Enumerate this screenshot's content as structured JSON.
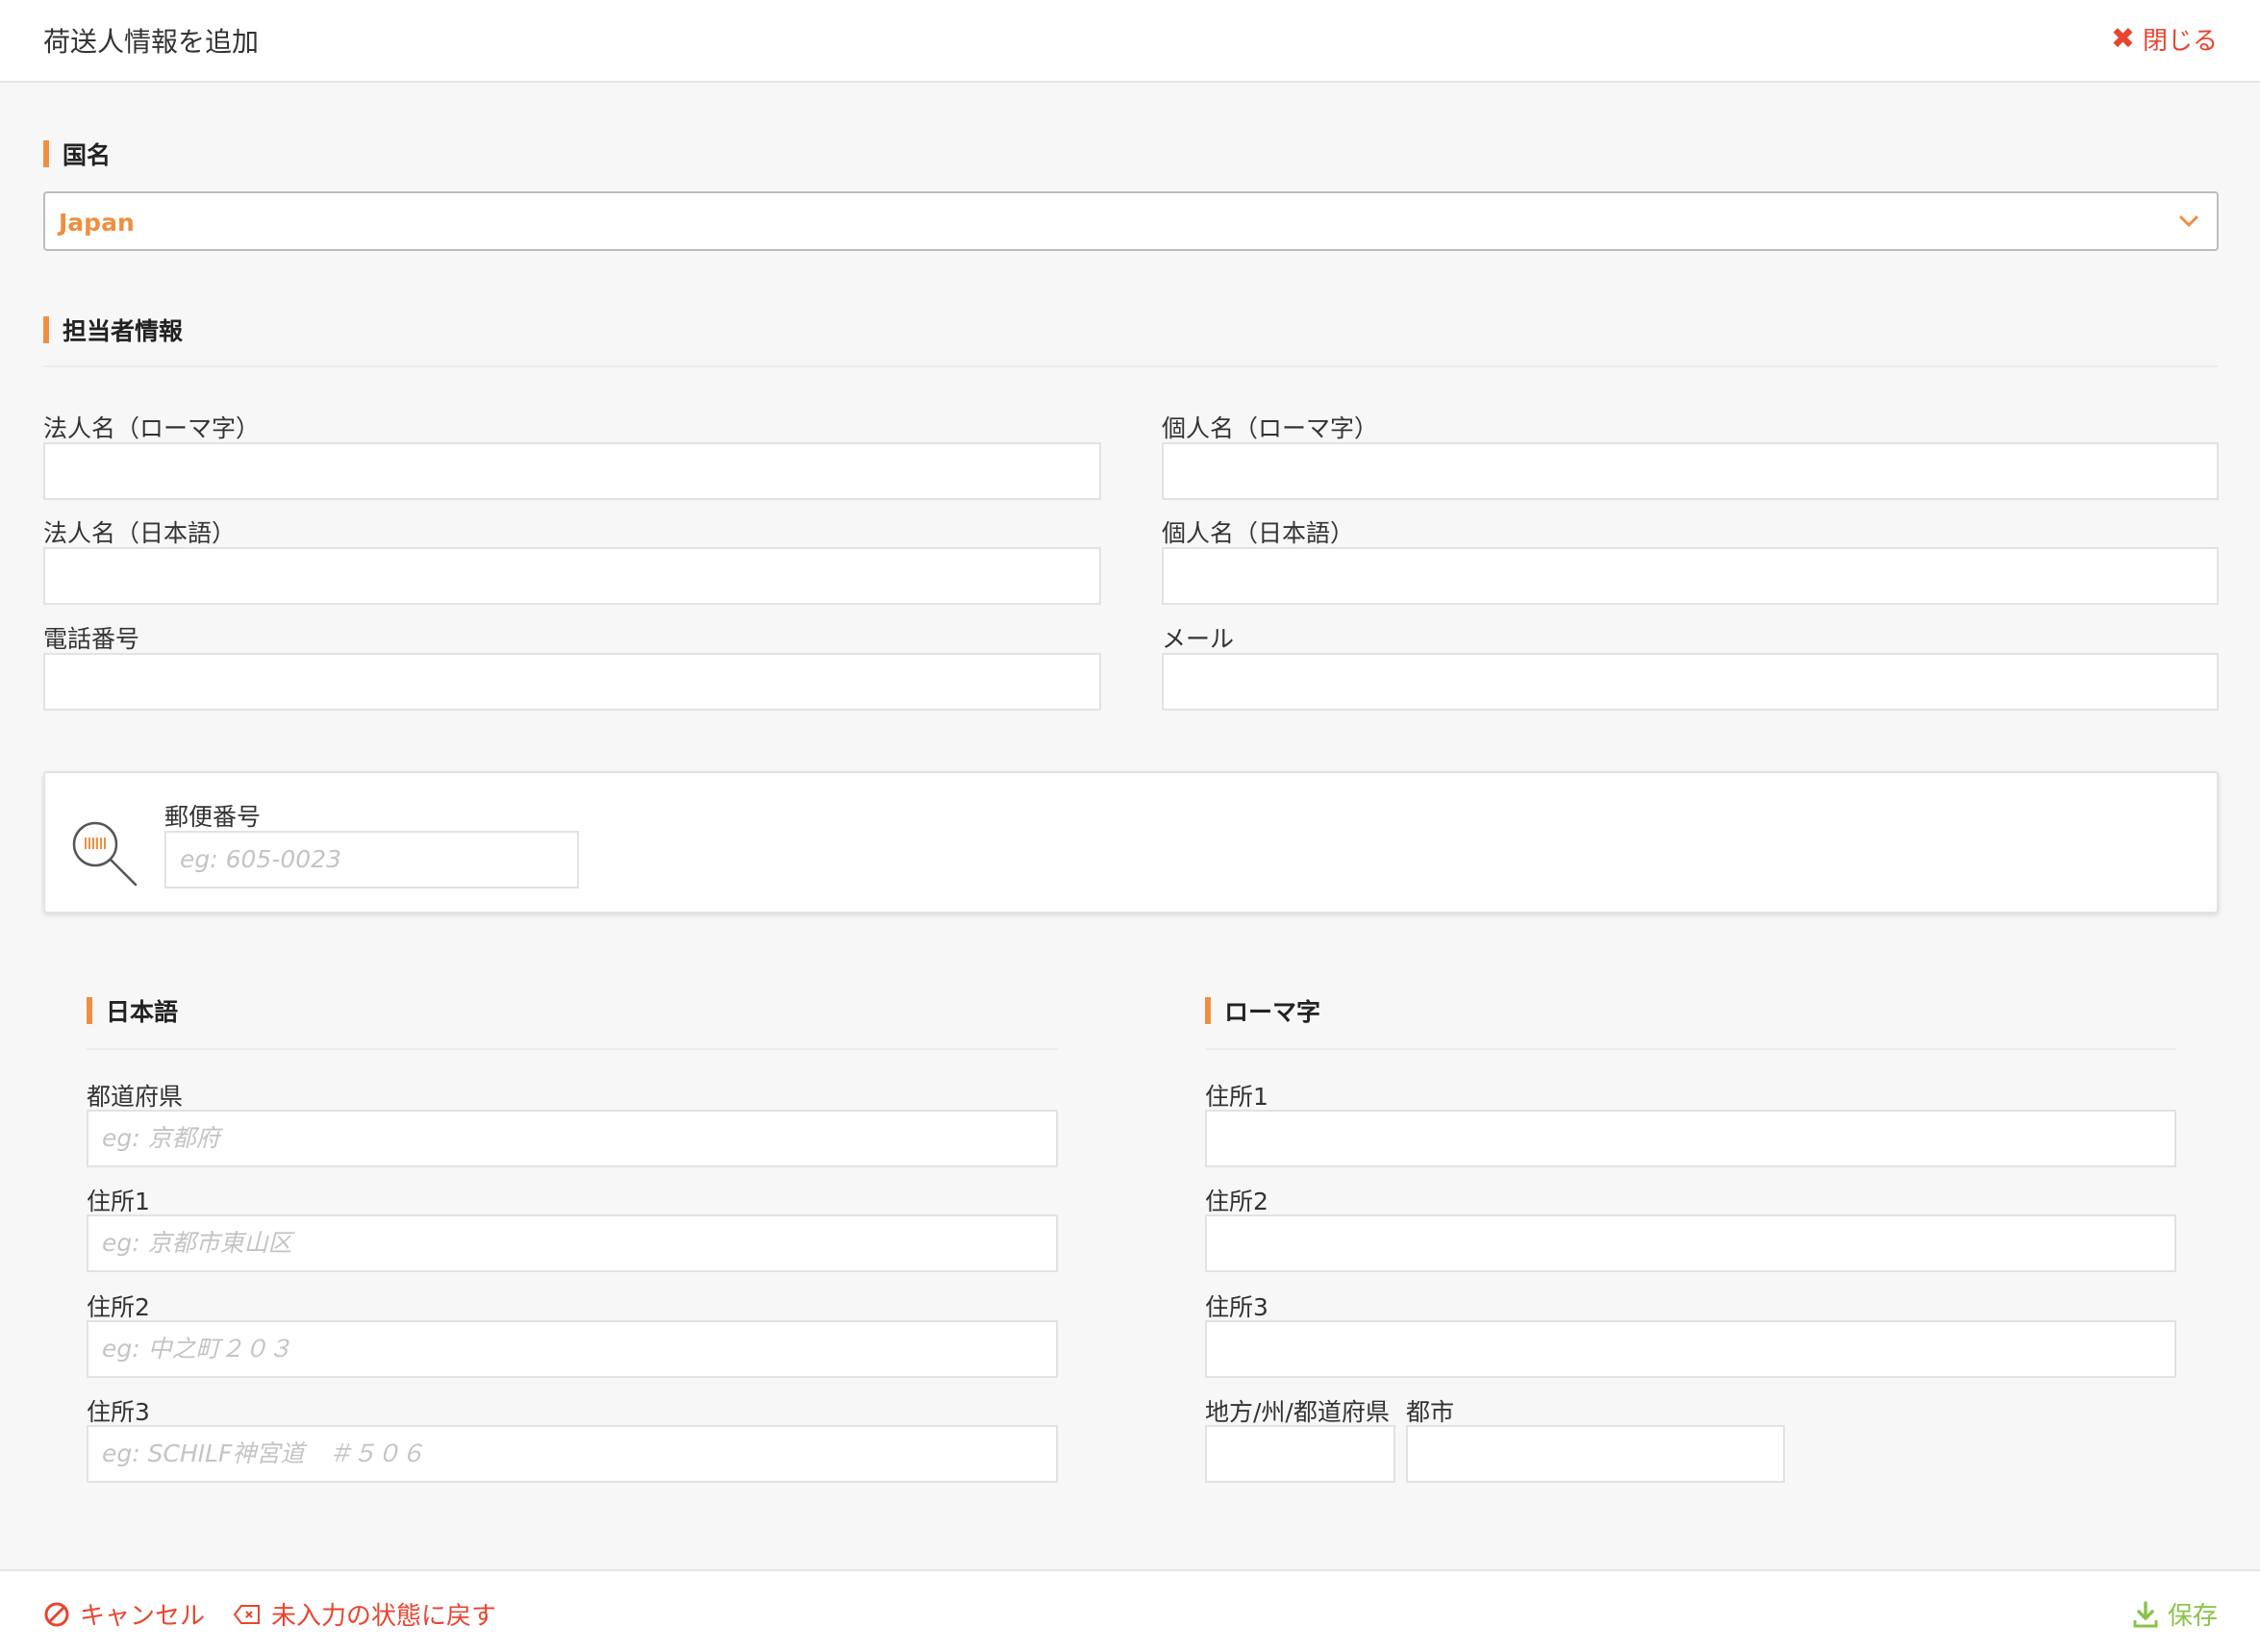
{
  "header": {
    "title": "荷送人情報を追加",
    "close_label": "閉じる"
  },
  "country": {
    "section_title": "国名",
    "selected": "Japan"
  },
  "contact": {
    "section_title": "担当者情報",
    "company_roman_label": "法人名（ローマ字）",
    "person_roman_label": "個人名（ローマ字）",
    "company_jp_label": "法人名（日本語）",
    "person_jp_label": "個人名（日本語）",
    "phone_label": "電話番号",
    "email_label": "メール",
    "company_roman_value": "",
    "person_roman_value": "",
    "company_jp_value": "",
    "person_jp_value": "",
    "phone_value": "",
    "email_value": ""
  },
  "postal": {
    "label": "郵便番号",
    "placeholder": "eg: 605-0023"
  },
  "address_jp": {
    "section_title": "日本語",
    "prefecture_label": "都道府県",
    "prefecture_placeholder": "eg: 京都府",
    "address1_label": "住所1",
    "address1_placeholder": "eg: 京都市東山区",
    "address2_label": "住所2",
    "address2_placeholder": "eg: 中之町２０３",
    "address3_label": "住所3",
    "address3_placeholder": "eg: SCHILF神宮道　＃５０６"
  },
  "address_roman": {
    "section_title": "ローマ字",
    "address1_label": "住所1",
    "address2_label": "住所2",
    "address3_label": "住所3",
    "region_label": "地方/州/都道府県",
    "city_label": "都市"
  },
  "footer": {
    "cancel_label": "キャンセル",
    "reset_label": "未入力の状態に戻す",
    "save_label": "保存"
  },
  "colors": {
    "accent": "#ef8f3f",
    "danger": "#e8452f",
    "save": "#8bc34a"
  }
}
